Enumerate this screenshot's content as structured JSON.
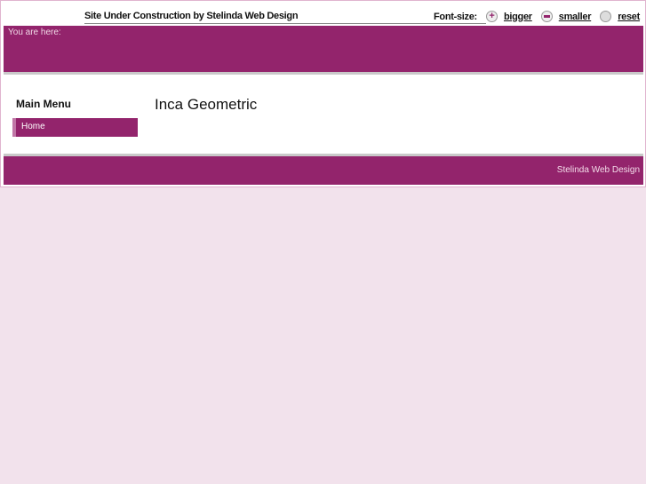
{
  "header": {
    "site_title": "Site Under Construction by Stelinda Web Design",
    "font_size": {
      "label": "Font-size:",
      "bigger": "bigger",
      "smaller": "smaller",
      "reset": "reset"
    }
  },
  "breadcrumb": {
    "label": "You are here:"
  },
  "sidebar": {
    "title": "Main Menu",
    "items": [
      {
        "label": "Home"
      }
    ]
  },
  "main": {
    "title": "Inca Geometric"
  },
  "footer": {
    "text": "Stelinda Web Design"
  },
  "colors": {
    "accent": "#93246c",
    "background": "#f2e2ec"
  }
}
